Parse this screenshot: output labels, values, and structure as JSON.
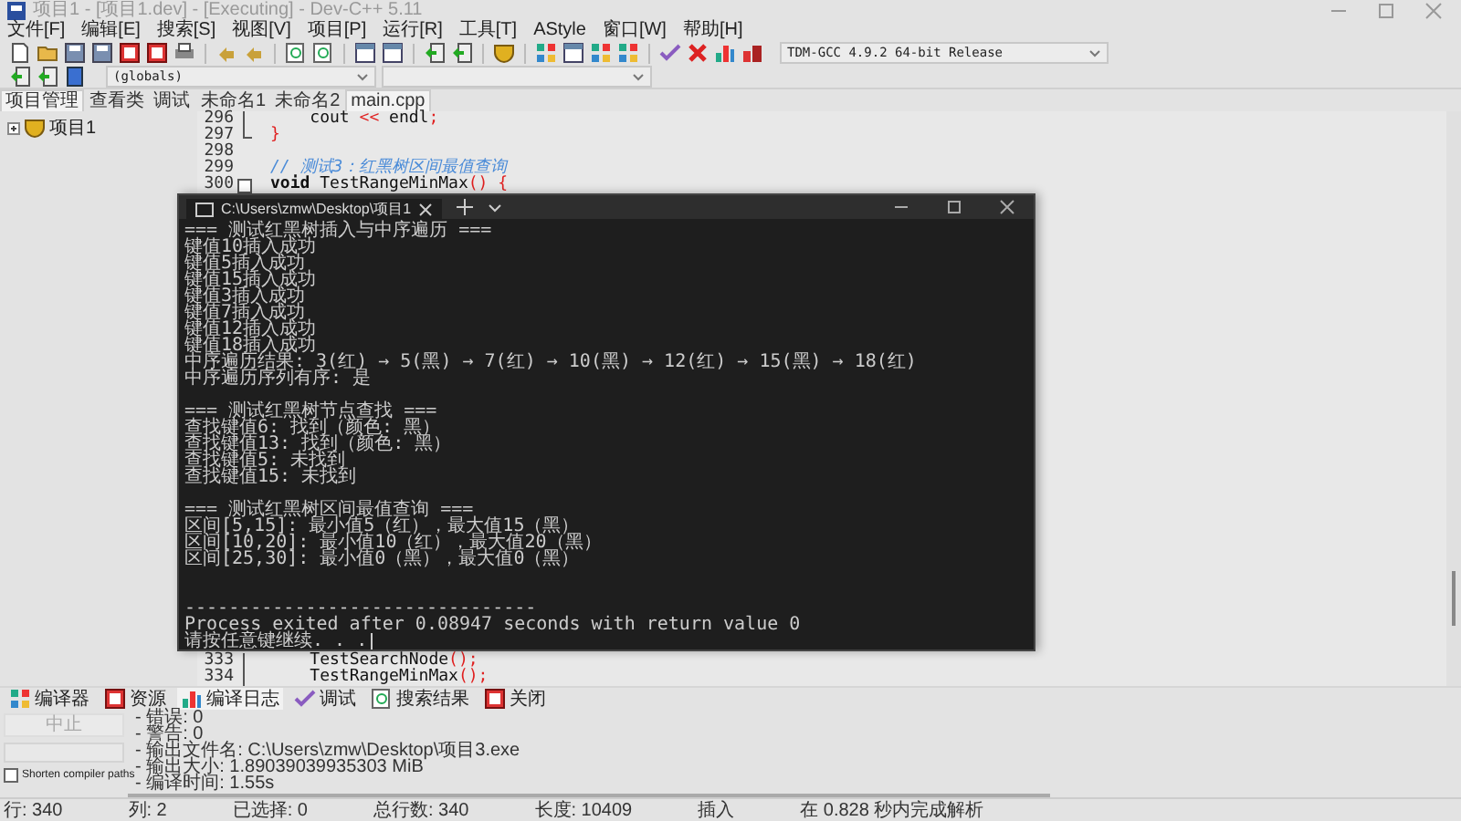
{
  "window": {
    "title": "项目1 - [项目1.dev] - [Executing] - Dev-C++ 5.11"
  },
  "menu": [
    "文件[F]",
    "编辑[E]",
    "搜索[S]",
    "视图[V]",
    "项目[P]",
    "运行[R]",
    "工具[T]",
    "AStyle",
    "窗口[W]",
    "帮助[H]"
  ],
  "toolbar": {
    "compiler": "TDM-GCC 4.9.2 64-bit Release",
    "scope": "(globals)"
  },
  "left_panel": {
    "tabs": [
      {
        "label": "项目管理",
        "selected": true
      },
      {
        "label": "查看类",
        "selected": false
      },
      {
        "label": "调试",
        "selected": false
      }
    ],
    "tree": [
      {
        "label": "项目1",
        "expanded": false
      }
    ]
  },
  "editor": {
    "tabs": [
      {
        "label": "未命名1",
        "selected": false
      },
      {
        "label": "未命名2",
        "selected": false
      },
      {
        "label": "main.cpp",
        "selected": true
      }
    ],
    "lines_top": [
      {
        "number": "296",
        "kind": "body",
        "tokens": [
          {
            "kind": "plain",
            "text": "    cout "
          },
          {
            "kind": "op",
            "text": "<<"
          },
          {
            "kind": "plain",
            "text": " endl"
          },
          {
            "kind": "op",
            "text": ";"
          }
        ]
      },
      {
        "number": "297",
        "kind": "end",
        "tokens": [
          {
            "kind": "op",
            "text": "}"
          }
        ]
      },
      {
        "number": "298",
        "kind": "plain"
      },
      {
        "number": "299",
        "kind": "plain",
        "tokens": [
          {
            "kind": "comment",
            "text": "// 测试3：红黑树区间最值查询"
          }
        ]
      },
      {
        "number": "300",
        "kind": "start",
        "tokens": [
          {
            "kind": "keyword",
            "text": "void"
          },
          {
            "kind": "plain",
            "text": " TestRangeMinMax"
          },
          {
            "kind": "op",
            "text": "() {"
          }
        ]
      }
    ],
    "lines_bottom": [
      {
        "number": "333",
        "kind": "body",
        "tokens": [
          {
            "kind": "plain",
            "text": "    TestSearchNode"
          },
          {
            "kind": "op",
            "text": "();"
          }
        ]
      },
      {
        "number": "334",
        "kind": "body",
        "tokens": [
          {
            "kind": "plain",
            "text": "    TestRangeMinMax"
          },
          {
            "kind": "op",
            "text": "();"
          }
        ]
      }
    ]
  },
  "console": {
    "title": "C:\\Users\\zmw\\Desktop\\项目1",
    "sections": [
      {
        "kind": "first",
        "lines": [
          "=== 测试红黑树插入与中序遍历 ===",
          "键值10插入成功",
          "键值5插入成功",
          "键值15插入成功",
          "键值3插入成功",
          "键值7插入成功",
          "键值12插入成功",
          "键值18插入成功",
          "中序遍历结果: 3(红) → 5(黑) → 7(红) → 10(黑) → 12(红) → 15(黑) → 18(红)",
          "中序遍历序列有序: 是"
        ]
      },
      {
        "kind": "spaced",
        "lines": [
          "=== 测试红黑树节点查找 ===",
          "查找键值6: 找到（颜色: 黑）",
          "查找键值13: 找到（颜色: 黑）",
          "查找键值5: 未找到",
          "查找键值15: 未找到"
        ]
      },
      {
        "kind": "spaced",
        "lines": [
          "=== 测试红黑树区间最值查询 ===",
          "区间[5,15]: 最小值5（红），最大值15（黑）",
          "区间[10,20]: 最小值10（红），最大值20（黑）",
          "区间[25,30]: 最小值0（黑），最大值0（黑）"
        ]
      },
      {
        "kind": "doublespaced",
        "lines": [
          "--------------------------------",
          "Process exited after 0.08947 seconds with return value 0",
          "请按任意键继续. . ."
        ]
      }
    ]
  },
  "bottom_panel": {
    "tabs": [
      {
        "label": "编译器",
        "selected": false
      },
      {
        "label": "资源",
        "selected": false
      },
      {
        "label": "编译日志",
        "selected": true
      },
      {
        "label": "调试",
        "selected": false
      },
      {
        "label": "搜索结果",
        "selected": false
      },
      {
        "label": "关闭",
        "selected": false
      }
    ],
    "abort_button": {
      "label": "中止",
      "disabled": true
    },
    "shorten_paths": {
      "label": "Shorten compiler paths",
      "checked": false
    },
    "log": [
      "- 错误: 0",
      "- 警告: 0",
      "- 输出文件名: C:\\Users\\zmw\\Desktop\\项目3.exe",
      "- 输出大小: 1.89039039935303 MiB",
      "- 编译时间: 1.55s"
    ]
  },
  "status_bar": [
    "行: 340",
    "列: 2",
    "已选择: 0",
    "总行数: 340",
    "长度: 10409",
    "插入",
    "在 0.828 秒内完成解析"
  ]
}
